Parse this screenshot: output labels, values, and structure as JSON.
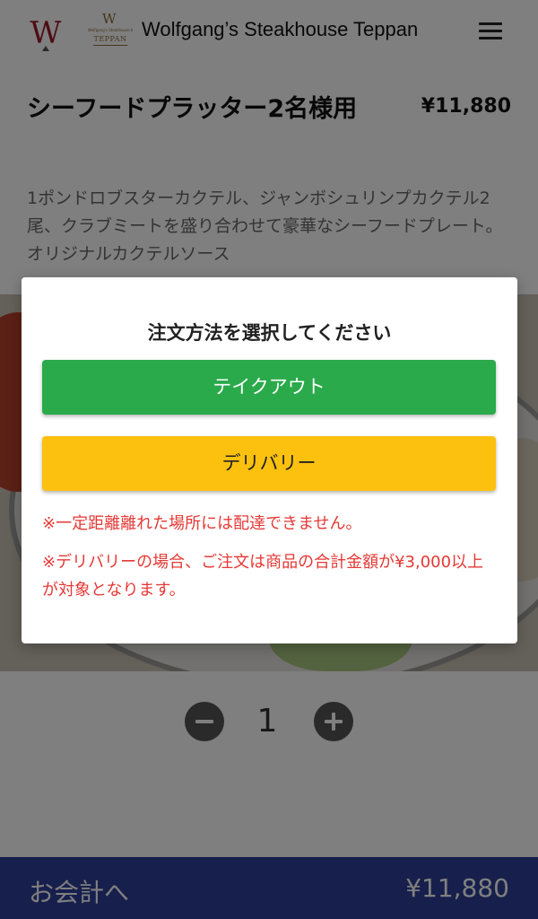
{
  "header": {
    "title": "Wolfgang’s Steakhouse Teppan",
    "logo_letter": "W",
    "teppan_logo": {
      "letter": "W",
      "subtitle": "Wolfgang's Steakhouse by Wolfgang Zwiener",
      "name": "TEPPAN"
    },
    "menu_icon": "hamburger-menu-icon"
  },
  "product": {
    "name": "シーフードプラッター2名様用",
    "price": "¥11,880",
    "description": "1ポンドロブスターカクテル、ジャンボシュリンプカクテル2尾、クラブミートを盛り合わせて豪華なシーフードプレート。オリジナルカクテルソース"
  },
  "quantity": {
    "value": "1",
    "minus_icon": "minus-circle-icon",
    "plus_icon": "plus-circle-icon"
  },
  "checkout": {
    "label": "お会計へ",
    "total": "¥11,880"
  },
  "modal": {
    "title": "注文方法を選択してください",
    "takeout_label": "テイクアウト",
    "delivery_label": "デリバリー",
    "note1": "※一定距離離れた場所には配達できません。",
    "note2": "※デリバリーの場合、ご注文は商品の合計金額が¥3,000以上が対象となります。"
  },
  "colors": {
    "brand_w": "#9b1b2a",
    "teppan_gold": "#8d6a3a",
    "takeout_green": "#2aaa4a",
    "delivery_yellow": "#fcc10e",
    "note_red": "#e53935",
    "checkout_navy": "#2e3f9a"
  }
}
